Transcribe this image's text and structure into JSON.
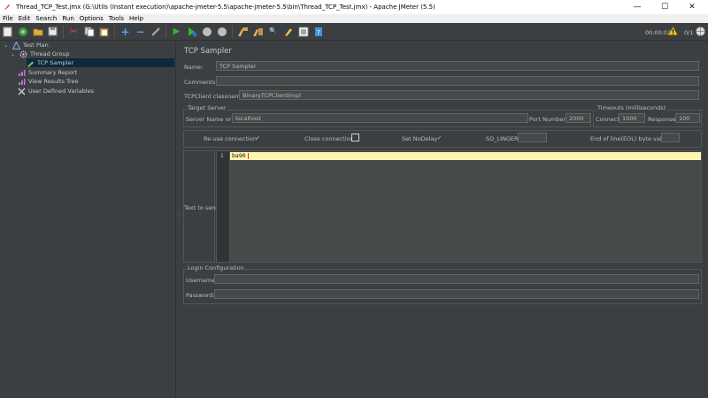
{
  "window": {
    "title": "Thread_TCP_Test.jmx (G:\\Utils (Instant execution)\\apache-jmeter-5.5\\apache-jmeter-5.5\\bin\\Thread_TCP_Test.jmx) - Apache JMeter (5.5)",
    "minimize": "—",
    "maximize": "☐",
    "close": "✕"
  },
  "menu": [
    "File",
    "Edit",
    "Search",
    "Run",
    "Options",
    "Tools",
    "Help"
  ],
  "toolbar": {
    "elapsed_time": "00:00:02",
    "thread_count": "0/1"
  },
  "tree": {
    "items": [
      {
        "label": "Test Plan"
      },
      {
        "label": "Thread Group"
      },
      {
        "label": "TCP Sampler"
      },
      {
        "label": "Summary Report"
      },
      {
        "label": "View Results Tree"
      },
      {
        "label": "User Defined Variables"
      }
    ]
  },
  "sampler": {
    "heading": "TCP Sampler",
    "name_label": "Name:",
    "name_value": "TCP Sampler",
    "comments_label": "Comments:",
    "comments_value": "",
    "classname_label": "TCPClient classname:",
    "classname_value": "BinaryTCPClientImpl",
    "target_server_title": "Target Server",
    "server_label": "Server Name or IP:",
    "server_value": "localhost",
    "port_label": "Port Number:",
    "port_value": "2000",
    "timeouts_title": "Timeouts (milliseconds)",
    "connect_label": "Connect:",
    "connect_value": "1000",
    "response_label": "Response:",
    "response_value": "100",
    "reuse_label": "Re-use connection",
    "close_label": "Close connection",
    "nodelay_label": "Set NoDelay",
    "solinger_label": "SO_LINGER:",
    "solinger_value": "",
    "eol_label": "End of line(EOL) byte value:",
    "eol_value": "",
    "text_to_send_label": "Text to send",
    "line_number": "1",
    "text_to_send_value": "ba90",
    "login_title": "Login Configuration",
    "username_label": "Username:",
    "username_value": "",
    "password_label": "Password:",
    "password_value": ""
  },
  "colors": {
    "background": "#3c3f41",
    "field": "#45494a",
    "selection": "#0d293e",
    "current_line": "#fff6b0"
  }
}
